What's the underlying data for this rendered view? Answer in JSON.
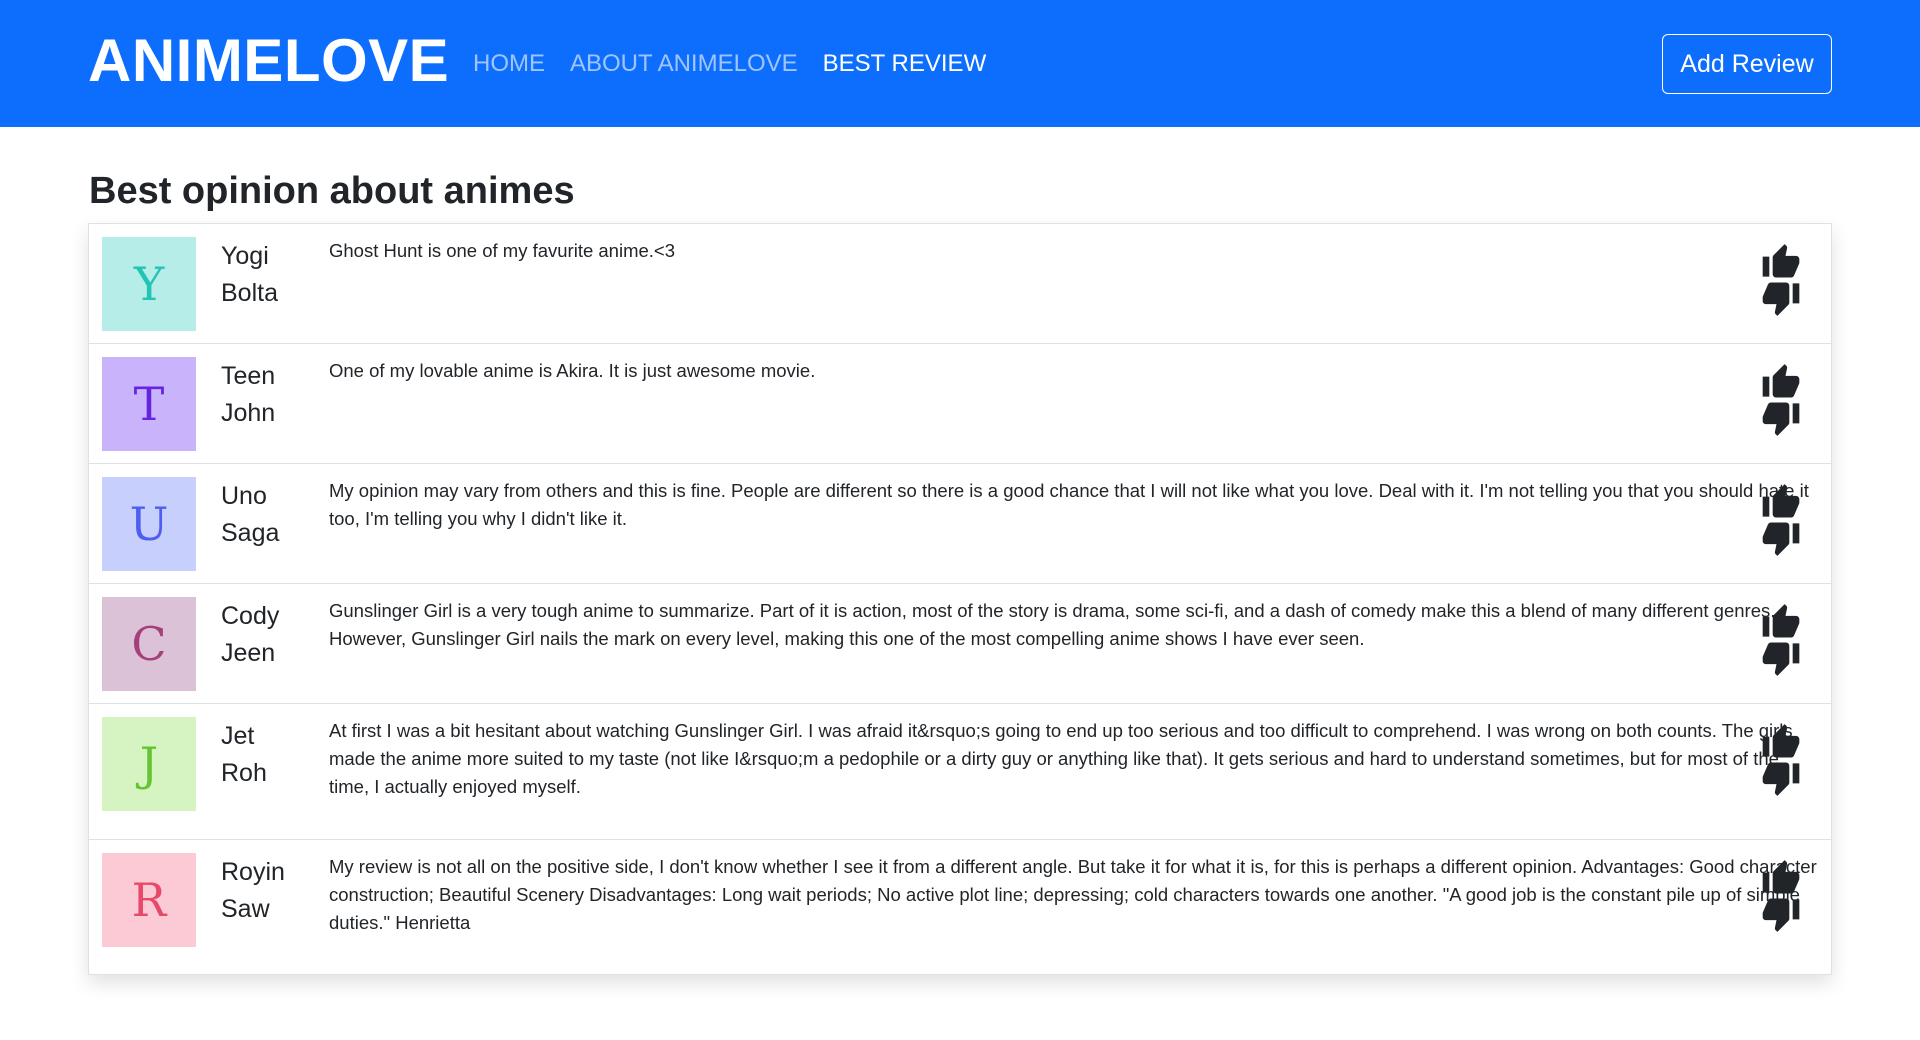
{
  "nav": {
    "brand": "ANIMELOVE",
    "links": [
      "HOME",
      "ABOUT ANIMELOVE",
      "BEST REVIEW"
    ],
    "add_review_label": "Add Review"
  },
  "page_title": "Best opinion about animes",
  "reviews": [
    {
      "initial": "Y",
      "first": "Yogi",
      "last": "Bolta",
      "text": "Ghost Hunt is one of my favurite anime.<3"
    },
    {
      "initial": "T",
      "first": "Teen",
      "last": "John",
      "text": "One of my lovable anime is Akira. It is just awesome movie."
    },
    {
      "initial": "U",
      "first": "Uno",
      "last": "Saga",
      "text": "My opinion may vary from others and this is fine. People are different so there is a good chance that I will not like what you love. Deal with it. I'm not telling you that you should hate it too, I'm telling you why I didn't like it."
    },
    {
      "initial": "C",
      "first": "Cody",
      "last": "Jeen",
      "text": "Gunslinger Girl is a very tough anime to summarize. Part of it is action, most of the story is drama, some sci-fi, and a dash of comedy make this a blend of many different genres. However, Gunslinger Girl nails the mark on every level, making this one of the most compelling anime shows I have ever seen."
    },
    {
      "initial": "J",
      "first": "Jet",
      "last": "Roh",
      "text": "At first I was a bit hesitant about watching Gunslinger Girl. I was afraid it&rsquo;s going to end up too serious and too difficult to comprehend. I was wrong on both counts. The girls made the anime more suited to my taste (not like I&rsquo;m a pedophile or a dirty guy or anything like that). It gets serious and hard to understand sometimes, but for most of the time, I actually enjoyed myself."
    },
    {
      "initial": "R",
      "first": "Royin",
      "last": "Saw",
      "text": "My review is not all on the positive side, I don't know whether I see it from a different angle. But take it for what it is, for this is perhaps a different opinion. Advantages: Good character construction; Beautiful Scenery Disadvantages: Long wait periods; No active plot line; depressing; cold characters towards one another. \"A good job is the constant pile up of simple duties.\" Henrietta"
    }
  ],
  "colors": {
    "navbar": "#0d6efd",
    "avatar_bg": [
      "#b6ede8",
      "#c9b3fb",
      "#c7d0fd",
      "#dcc2d6",
      "#d6f3c2",
      "#fbcad4"
    ],
    "avatar_fg": [
      "#22c4b4",
      "#6524e0",
      "#4f5ef0",
      "#a4407c",
      "#63c631",
      "#e8496a"
    ]
  },
  "icons": [
    "thumbs-up-icon",
    "thumbs-down-icon"
  ]
}
